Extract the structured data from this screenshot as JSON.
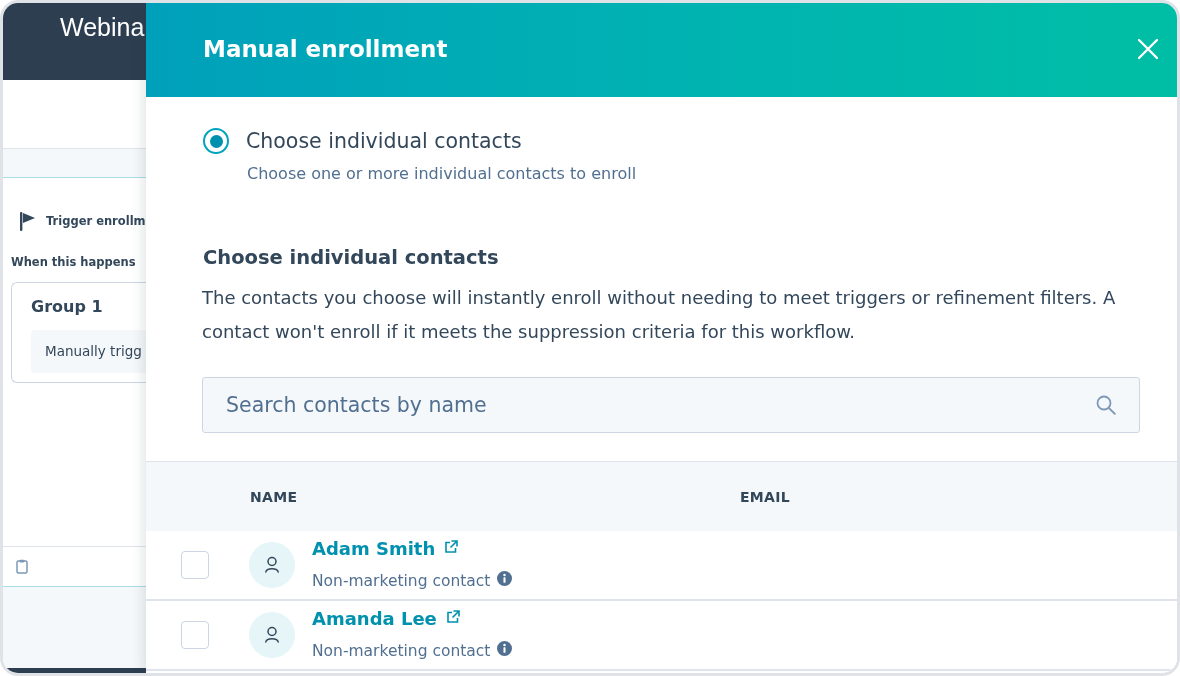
{
  "background_app": {
    "title": "Webina",
    "trigger_label": "Trigger enrollm",
    "condition_label": "When this happens",
    "group": {
      "title": "Group 1",
      "trigger": "Manually trigg"
    }
  },
  "dialog": {
    "title": "Manual enrollment",
    "options": [
      {
        "label": "Choose individual contacts",
        "description": "Choose one or more individual contacts to enroll",
        "selected": true
      }
    ],
    "section": {
      "title": "Choose individual contacts",
      "text": "The contacts you choose will instantly enroll without needing to meet triggers or refinement filters. A contact won't enroll if it meets the suppression criteria for this workflow."
    },
    "search": {
      "placeholder": "Search contacts by name"
    },
    "table": {
      "columns": [
        "NAME",
        "EMAIL"
      ],
      "rows": [
        {
          "name": "Adam Smith",
          "type": "Non-marketing contact",
          "checked": false
        },
        {
          "name": "Amanda Lee",
          "type": "Non-marketing contact",
          "checked": false
        }
      ]
    }
  }
}
